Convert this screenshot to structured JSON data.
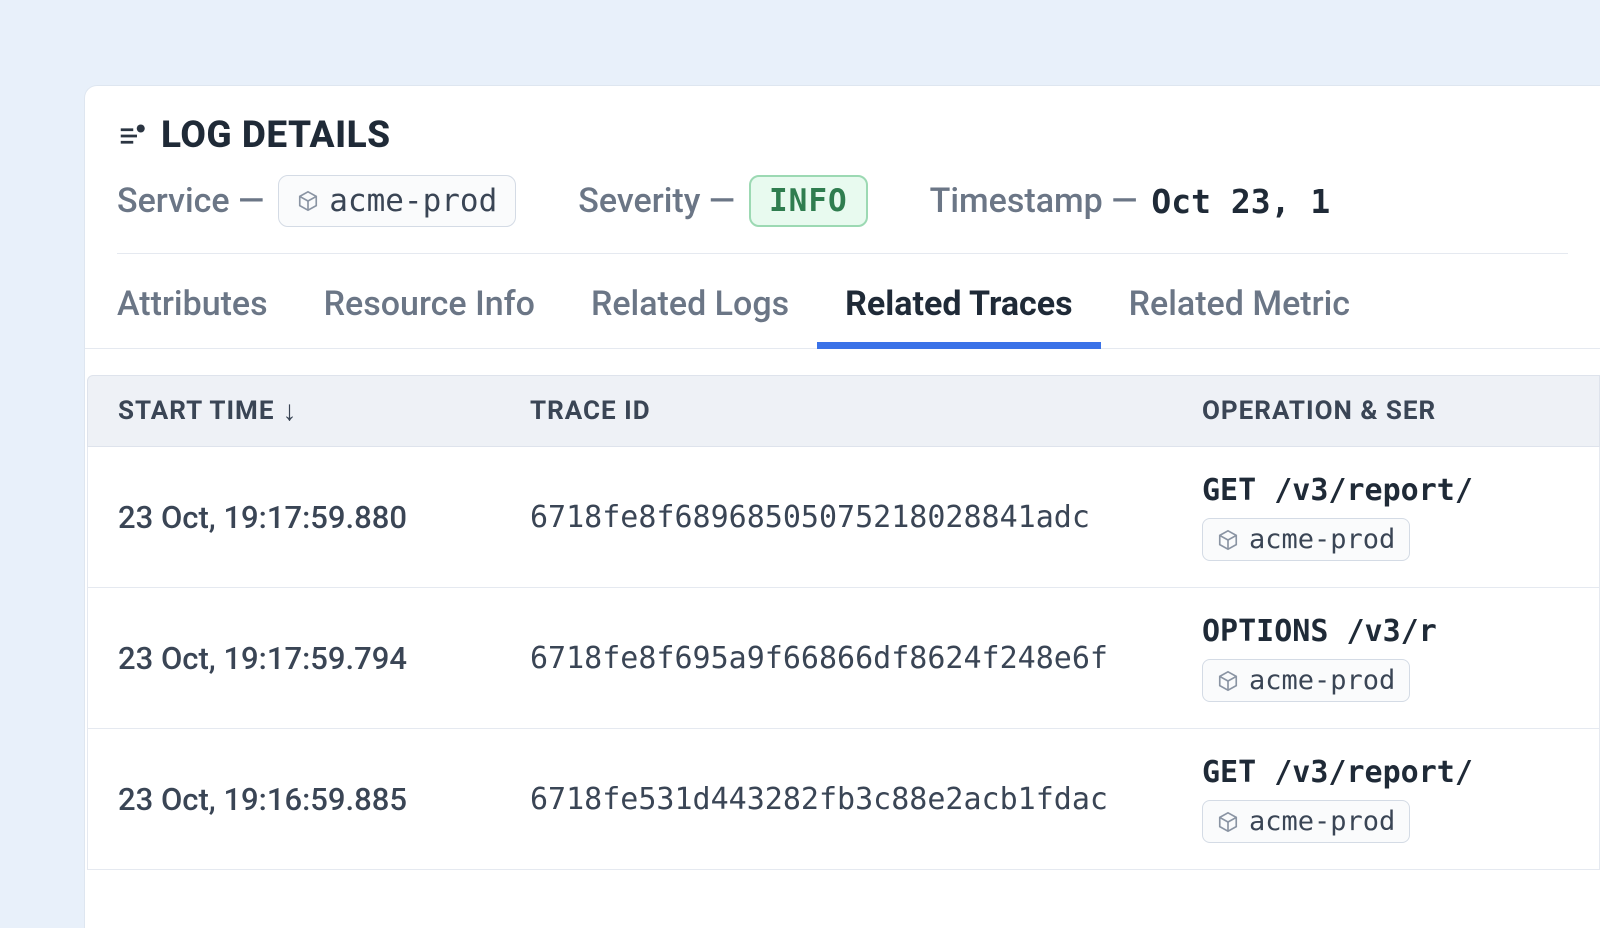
{
  "header": {
    "title": "LOG DETAILS",
    "service_label": "Service —",
    "service_value": "acme-prod",
    "severity_label": "Severity —",
    "severity_value": "INFO",
    "timestamp_label": "Timestamp —",
    "timestamp_value": "Oct 23, 1"
  },
  "tabs": {
    "attributes": "Attributes",
    "resource_info": "Resource Info",
    "related_logs": "Related Logs",
    "related_traces": "Related Traces",
    "related_metrics": "Related Metric"
  },
  "table": {
    "columns": {
      "start_time": "START TIME",
      "trace_id": "TRACE ID",
      "operation": "OPERATION & SER"
    },
    "rows": [
      {
        "start_time": "23 Oct, 19:17:59.880",
        "trace_id": "6718fe8f68968505075218028841adc",
        "operation": "GET /v3/report/",
        "service": "acme-prod"
      },
      {
        "start_time": "23 Oct, 19:17:59.794",
        "trace_id": "6718fe8f695a9f66866df8624f248e6f",
        "operation": "OPTIONS /v3/r",
        "service": "acme-prod"
      },
      {
        "start_time": "23 Oct, 19:16:59.885",
        "trace_id": "6718fe531d443282fb3c88e2acb1fdac",
        "operation": "GET /v3/report/",
        "service": "acme-prod"
      }
    ]
  }
}
